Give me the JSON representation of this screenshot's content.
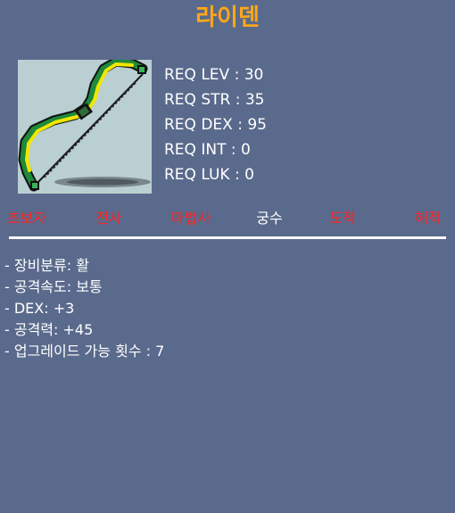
{
  "item": {
    "name": "라이덴",
    "icon": "bow-icon"
  },
  "requirements": [
    "REQ LEV : 30",
    "REQ STR : 35",
    "REQ DEX : 95",
    "REQ INT : 0",
    "REQ LUK : 0"
  ],
  "jobs": [
    {
      "label": "초보자",
      "eligible": false
    },
    {
      "label": "전사",
      "eligible": false
    },
    {
      "label": "마법사",
      "eligible": false
    },
    {
      "label": "궁수",
      "eligible": true
    },
    {
      "label": "도적",
      "eligible": false
    },
    {
      "label": "해적",
      "eligible": false
    }
  ],
  "stats": [
    "- 장비분류: 활",
    "- 공격속도: 보통",
    "- DEX: +3",
    "- 공격력: +45",
    "- 업그레이드 가능 횟수 : 7"
  ],
  "colors": {
    "background": "#5a6a8c",
    "name": "#ffa718",
    "job_eligible": "#ffffff",
    "job_ineligible": "#ff2222",
    "icon_background": "#b9cfd2"
  }
}
